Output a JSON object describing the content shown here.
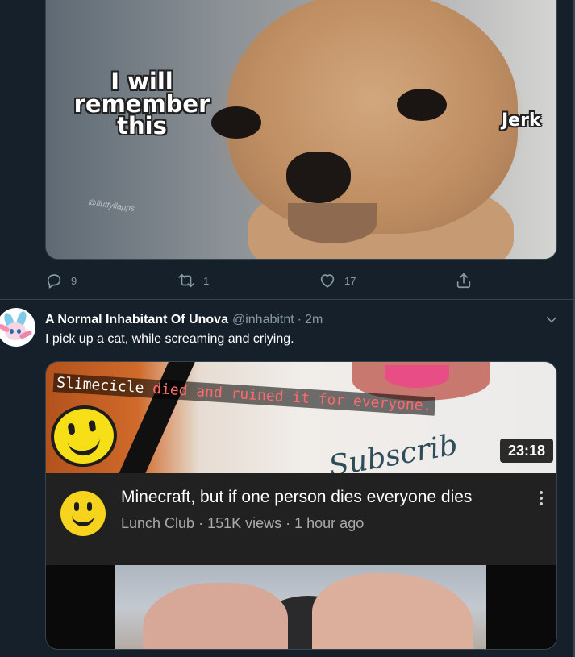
{
  "tweet1": {
    "media": {
      "caption_left": "I will remember this",
      "caption_right": "Jerk",
      "watermark": "@fluffyflapps"
    },
    "actions": {
      "reply_count": "9",
      "retweet_count": "1",
      "like_count": "17"
    }
  },
  "tweet2": {
    "author_name": "A Normal Inhabitant Of Unova",
    "handle": "@inhabitnt",
    "separator": "·",
    "time": "2m",
    "text": "I pick up a cat, while screaming and criying.",
    "video": {
      "overlay_name": "Slimecicle",
      "overlay_rest": " died and ruined it for everyone.",
      "shirt_text": "Subscrib",
      "duration": "23:18",
      "title": "Minecraft, but if one person dies everyone dies",
      "channel": "Lunch Club",
      "views": "151K views",
      "age": "1 hour ago",
      "meta_separator": " · "
    }
  },
  "colors": {
    "background": "#15202b",
    "border": "#38444d",
    "secondary_text": "#8899a6",
    "primary_text": "#ffffff"
  }
}
